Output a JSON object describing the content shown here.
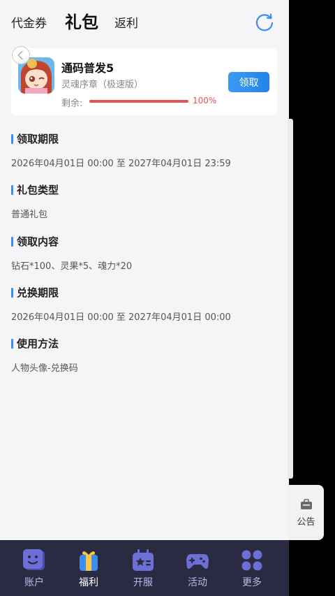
{
  "top_tabs": {
    "voucher": "代金券",
    "gift": "礼包",
    "rebate": "返利"
  },
  "gift_card": {
    "title": "通码普发5",
    "game": "灵魂序章（极速版）",
    "remain_label": "剩余:",
    "remain_percent_text": "100%",
    "remain_fraction": 1.0,
    "claim_label": "领取"
  },
  "sections": [
    {
      "heading": "领取期限",
      "body": "2026年04月01日 00:00 至 2027年04月01日 23:59"
    },
    {
      "heading": "礼包类型",
      "body": "普通礼包"
    },
    {
      "heading": "领取内容",
      "body": "钻石*100、灵果*5、魂力*20"
    },
    {
      "heading": "兑换期限",
      "body": "2026年04月01日 00:00 至 2027年04月01日 00:00"
    },
    {
      "heading": "使用方法",
      "body": "人物头像-兑换码"
    }
  ],
  "notice": {
    "label": "公告"
  },
  "bottom_nav": [
    {
      "label": "账户",
      "icon": "account-icon"
    },
    {
      "label": "福利",
      "icon": "gift-box-icon",
      "active": true
    },
    {
      "label": "开服",
      "icon": "server-open-icon"
    },
    {
      "label": "活动",
      "icon": "gamepad-icon"
    },
    {
      "label": "更多",
      "icon": "grid-more-icon"
    }
  ],
  "colors": {
    "accent": "#3b8ef0",
    "progress": "#e65354",
    "nav_bg": "#2a2a42",
    "nav_icon": "#6b6fd6"
  }
}
